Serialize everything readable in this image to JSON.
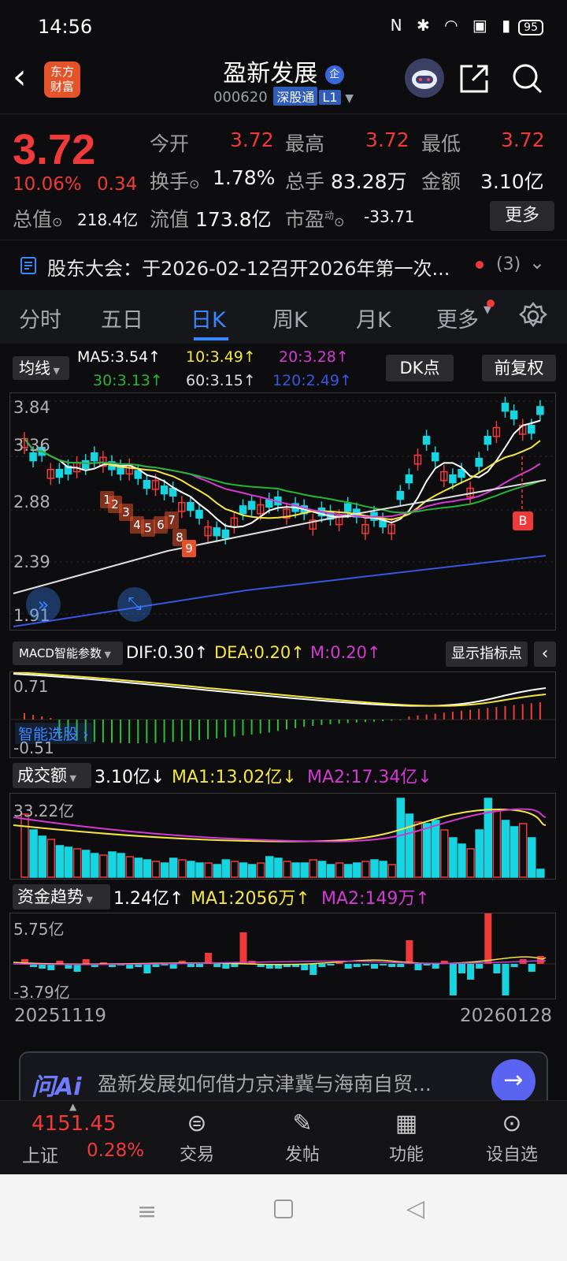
{
  "status_bar": {
    "time": "14:56",
    "icons": "N ✱ ◠ ▣ ▮",
    "battery": "95"
  },
  "header": {
    "logo_line1": "东方",
    "logo_line2": "财富",
    "stock_name": "盈新发展",
    "name_badge": "企",
    "stock_code": "000620",
    "tag_connect": "深股通",
    "tag_level": "L1"
  },
  "quote": {
    "price": "3.72",
    "change_pct": "10.06%",
    "change_abs": "0.34",
    "open_label": "今开",
    "open": "3.72",
    "high_label": "最高",
    "high": "3.72",
    "low_label": "最低",
    "low": "3.72",
    "turnover_label": "换手",
    "turnover": "1.78%",
    "volume_label": "总手",
    "volume": "83.28万",
    "amount_label": "金额",
    "amount": "3.10亿",
    "mktcap_label": "总值",
    "mktcap": "218.4亿",
    "float_label": "流值",
    "float_cap": "173.8亿",
    "pe_label": "市盈",
    "pe_sup": "动",
    "pe": "-33.71",
    "more": "更多"
  },
  "notice": {
    "text": "股东大会：于2026-02-12召开2026年第一次...",
    "count": "(3)"
  },
  "tabs": [
    "分时",
    "五日",
    "日K",
    "周K",
    "月K",
    "更多"
  ],
  "kline": {
    "ma_button": "均线",
    "ma5": "MA5:3.54↑",
    "ma10": "10:3.49↑",
    "ma20": "20:3.28↑",
    "ma30": "30:3.13↑",
    "ma60": "60:3.15↑",
    "ma120": "120:2.49↑",
    "dk_button": "DK点",
    "adjust_button": "前复权",
    "y_ticks": [
      "3.84",
      "3.36",
      "2.88",
      "2.39",
      "1.91"
    ],
    "seq_labels": [
      "1",
      "2",
      "3",
      "4",
      "5",
      "6",
      "7",
      "8",
      "9"
    ],
    "b_marker": "B"
  },
  "macd": {
    "param_button": "MACD智能参数",
    "dif": "DIF:0.30↑",
    "dea": "DEA:0.20↑",
    "m": "M:0.20↑",
    "show_points_button": "显示指标点",
    "y_top": "0.71",
    "y_bottom": "-0.51",
    "smart_pick": "智能选股"
  },
  "volume": {
    "label": "成交额",
    "value": "3.10亿↓",
    "ma1": "MA1:13.02亿↓",
    "ma2": "MA2:17.34亿↓",
    "y_top": "33.22亿"
  },
  "fund": {
    "label": "资金趋势",
    "value": "1.24亿↑",
    "ma1": "MA1:2056万↑",
    "ma2": "MA2:149万↑",
    "y_top": "5.75亿",
    "y_bottom": "-3.79亿"
  },
  "dates": {
    "start": "20251119",
    "end": "20260128"
  },
  "ai_bar": {
    "logo": "问Ai",
    "prompt": "盈新发展如何借力京津冀与海南自贸..."
  },
  "bottom_nav": {
    "index_value": "4151.45",
    "index_name": "上证",
    "index_change": "0.28%",
    "items": [
      "交易",
      "发帖",
      "功能",
      "设自选"
    ]
  },
  "colors": {
    "up": "#f03a3a",
    "down": "#17d5e0",
    "accent": "#3a86ff",
    "ma5": "#ffffff",
    "ma10": "#f5e642",
    "ma20": "#d23ad2",
    "ma30": "#27b43a",
    "ma120": "#3a55e0"
  }
}
